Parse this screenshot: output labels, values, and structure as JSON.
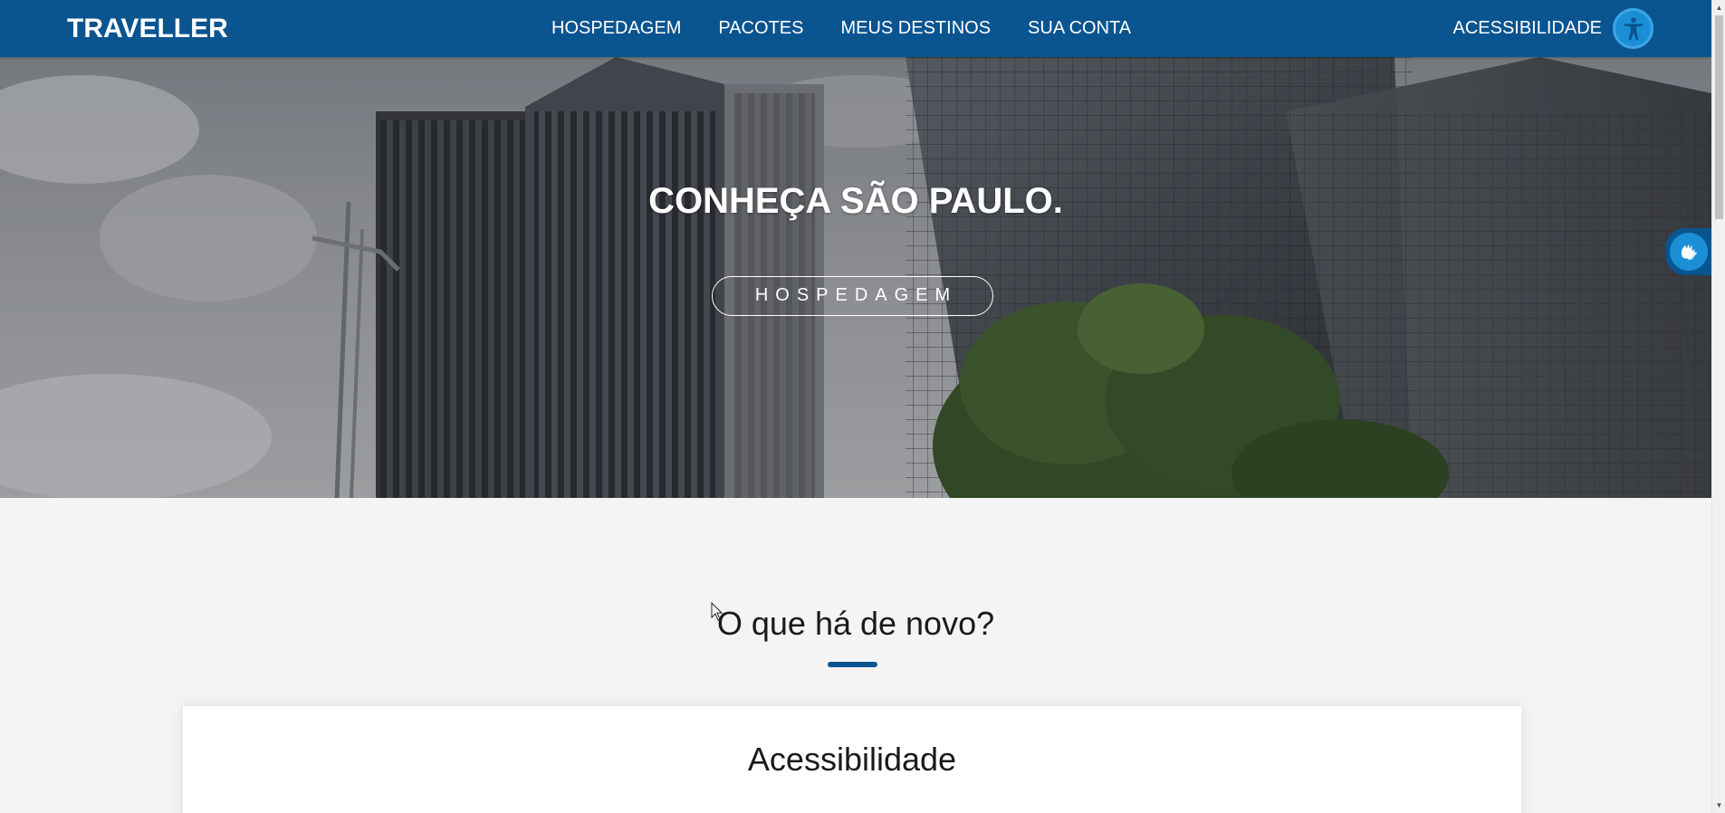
{
  "brand": "TRAVELLER",
  "nav": {
    "links": [
      "HOSPEDAGEM",
      "PACOTES",
      "MEUS DESTINOS",
      "SUA CONTA"
    ],
    "accessibility_label": "ACESSIBILIDADE",
    "accessibility_icon": "accessibility-person-icon"
  },
  "hero": {
    "title": "CONHEÇA SÃO PAULO.",
    "button_label": "HOSPEDAGEM"
  },
  "libras_widget": {
    "icon": "sign-language-hands-icon"
  },
  "section": {
    "title": "O que há de novo?"
  },
  "card": {
    "title": "Acessibilidade"
  },
  "colors": {
    "primary": "#0a5490",
    "accent": "#1b8fd6",
    "background": "#f3f4f3"
  }
}
